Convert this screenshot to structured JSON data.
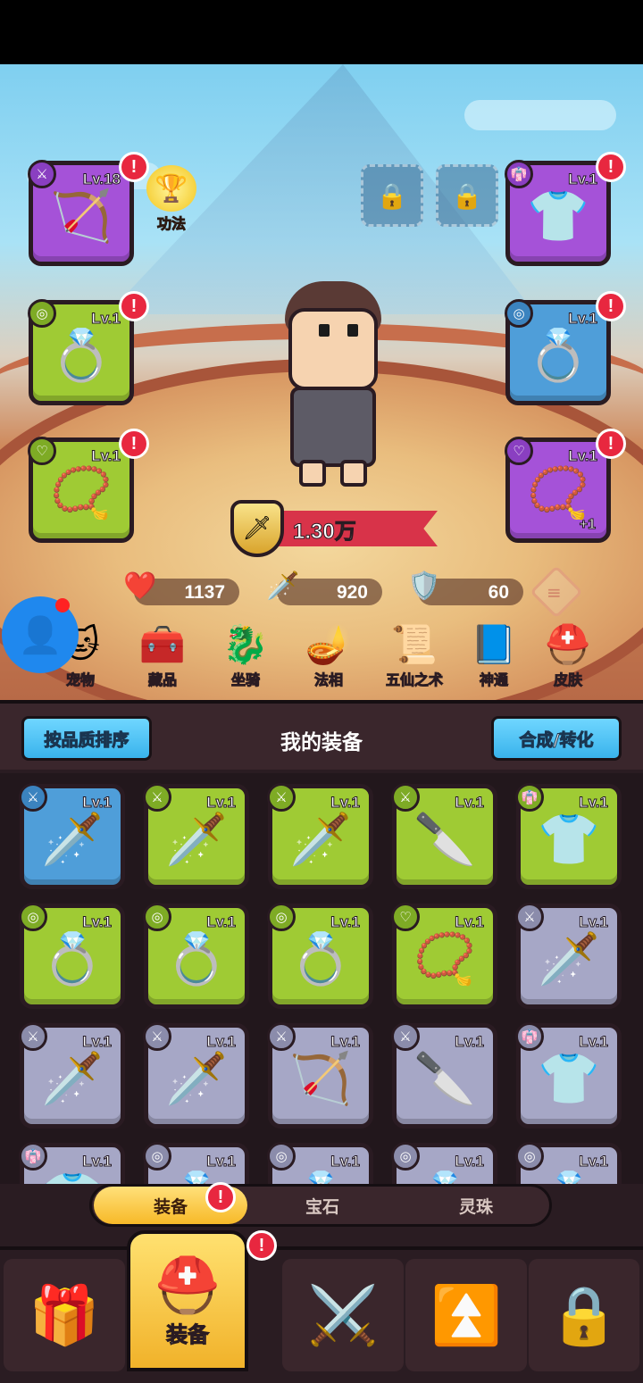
{
  "gongfa": {
    "label": "功法"
  },
  "top_slots": {
    "weapon": {
      "level": "Lv.18",
      "icon": "bow-icon"
    },
    "armor": {
      "level": "Lv.1",
      "icon": "robe-icon"
    },
    "ring_left": {
      "level": "Lv.1",
      "icon": "ring-icon"
    },
    "ring_right": {
      "level": "Lv.1",
      "icon": "ring-icon"
    },
    "necklace_left": {
      "level": "Lv.1",
      "icon": "necklace-icon"
    },
    "necklace_right": {
      "level": "Lv.1",
      "plus": "+1",
      "icon": "necklace-icon"
    }
  },
  "combat_power": "1.30万",
  "stats": {
    "hp": "1137",
    "attack": "920",
    "defense": "60"
  },
  "features": [
    {
      "label": "宠物",
      "icon": "pet-icon"
    },
    {
      "label": "藏品",
      "icon": "chest-icon"
    },
    {
      "label": "坐骑",
      "icon": "mount-icon"
    },
    {
      "label": "法相",
      "icon": "lamp-icon"
    },
    {
      "label": "五仙之术",
      "icon": "scroll-icon"
    },
    {
      "label": "神通",
      "icon": "book-icon"
    },
    {
      "label": "皮肤",
      "icon": "helmet-icon"
    }
  ],
  "panel": {
    "sort_label": "按品质排序",
    "title": "我的装备",
    "merge_label": "合成/转化"
  },
  "inventory": [
    {
      "level": "Lv.1",
      "quality": "blue",
      "icon": "sword-icon"
    },
    {
      "level": "Lv.1",
      "quality": "green",
      "icon": "sword-icon"
    },
    {
      "level": "Lv.1",
      "quality": "green",
      "icon": "sword-icon"
    },
    {
      "level": "Lv.1",
      "quality": "green",
      "icon": "blade-icon"
    },
    {
      "level": "Lv.1",
      "quality": "green",
      "icon": "robe-icon"
    },
    {
      "level": "Lv.1",
      "quality": "green",
      "icon": "ring-icon"
    },
    {
      "level": "Lv.1",
      "quality": "green",
      "icon": "ring-icon"
    },
    {
      "level": "Lv.1",
      "quality": "green",
      "icon": "ring-icon"
    },
    {
      "level": "Lv.1",
      "quality": "green",
      "icon": "necklace-icon"
    },
    {
      "level": "Lv.1",
      "quality": "gray",
      "icon": "sword-icon"
    },
    {
      "level": "Lv.1",
      "quality": "gray",
      "icon": "sword-icon"
    },
    {
      "level": "Lv.1",
      "quality": "gray",
      "icon": "sword-icon"
    },
    {
      "level": "Lv.1",
      "quality": "gray",
      "icon": "bow-icon"
    },
    {
      "level": "Lv.1",
      "quality": "gray",
      "icon": "blade-icon"
    },
    {
      "level": "Lv.1",
      "quality": "gray",
      "icon": "robe-icon"
    },
    {
      "level": "Lv.1",
      "quality": "gray",
      "icon": "robe-icon"
    },
    {
      "level": "Lv.1",
      "quality": "gray",
      "icon": "ring-icon"
    },
    {
      "level": "Lv.1",
      "quality": "gray",
      "icon": "ring-icon"
    },
    {
      "level": "Lv.1",
      "quality": "gray",
      "icon": "ring-icon"
    },
    {
      "level": "Lv.1",
      "quality": "gray",
      "icon": "ring-icon"
    }
  ],
  "tabs": [
    "装备",
    "宝石",
    "灵珠"
  ],
  "nav": {
    "active_label": "装备"
  }
}
